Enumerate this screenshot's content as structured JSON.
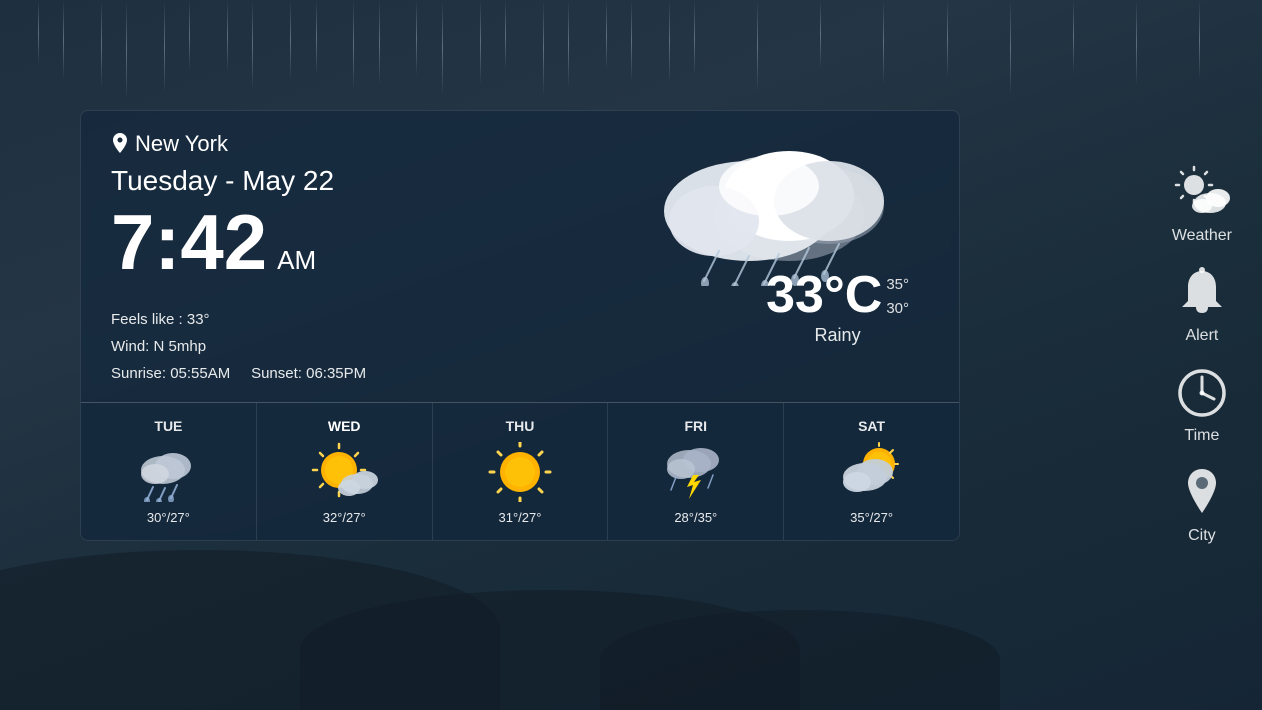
{
  "background": {
    "color_top": "#1e3040",
    "color_bottom": "#152535"
  },
  "location": {
    "name": "New York",
    "pin_icon": "📍"
  },
  "date": "Tuesday - May 22",
  "time": {
    "hour": "7:42",
    "ampm": "AM"
  },
  "weather": {
    "feels_like": "Feels like : 33°",
    "wind": "Wind: N 5mhp",
    "sunrise": "Sunrise: 05:55AM",
    "sunset": "Sunset: 06:35PM",
    "temperature": "33°C",
    "temp_high": "35°",
    "temp_low": "30°",
    "condition": "Rainy"
  },
  "forecast": [
    {
      "day": "TUE",
      "active": false,
      "type": "rainy_cloud",
      "high": "30°",
      "low": "27°",
      "temps": "30°/27°"
    },
    {
      "day": "WED",
      "active": true,
      "type": "partly_sunny",
      "high": "32°",
      "low": "27°",
      "temps": "32°/27°"
    },
    {
      "day": "THU",
      "active": false,
      "type": "sunny",
      "high": "31°",
      "low": "27°",
      "temps": "31°/27°"
    },
    {
      "day": "FRI",
      "active": false,
      "type": "stormy",
      "high": "28°",
      "low": "35°",
      "temps": "28°/35°"
    },
    {
      "day": "SAT",
      "active": false,
      "type": "partly_cloudy_sun",
      "high": "35°",
      "low": "27°",
      "temps": "35°/27°"
    }
  ],
  "sidebar": {
    "items": [
      {
        "label": "Weather",
        "icon": "weather-icon"
      },
      {
        "label": "Alert",
        "icon": "alert-icon"
      },
      {
        "label": "Time",
        "icon": "time-icon"
      },
      {
        "label": "City",
        "icon": "city-icon"
      }
    ]
  }
}
